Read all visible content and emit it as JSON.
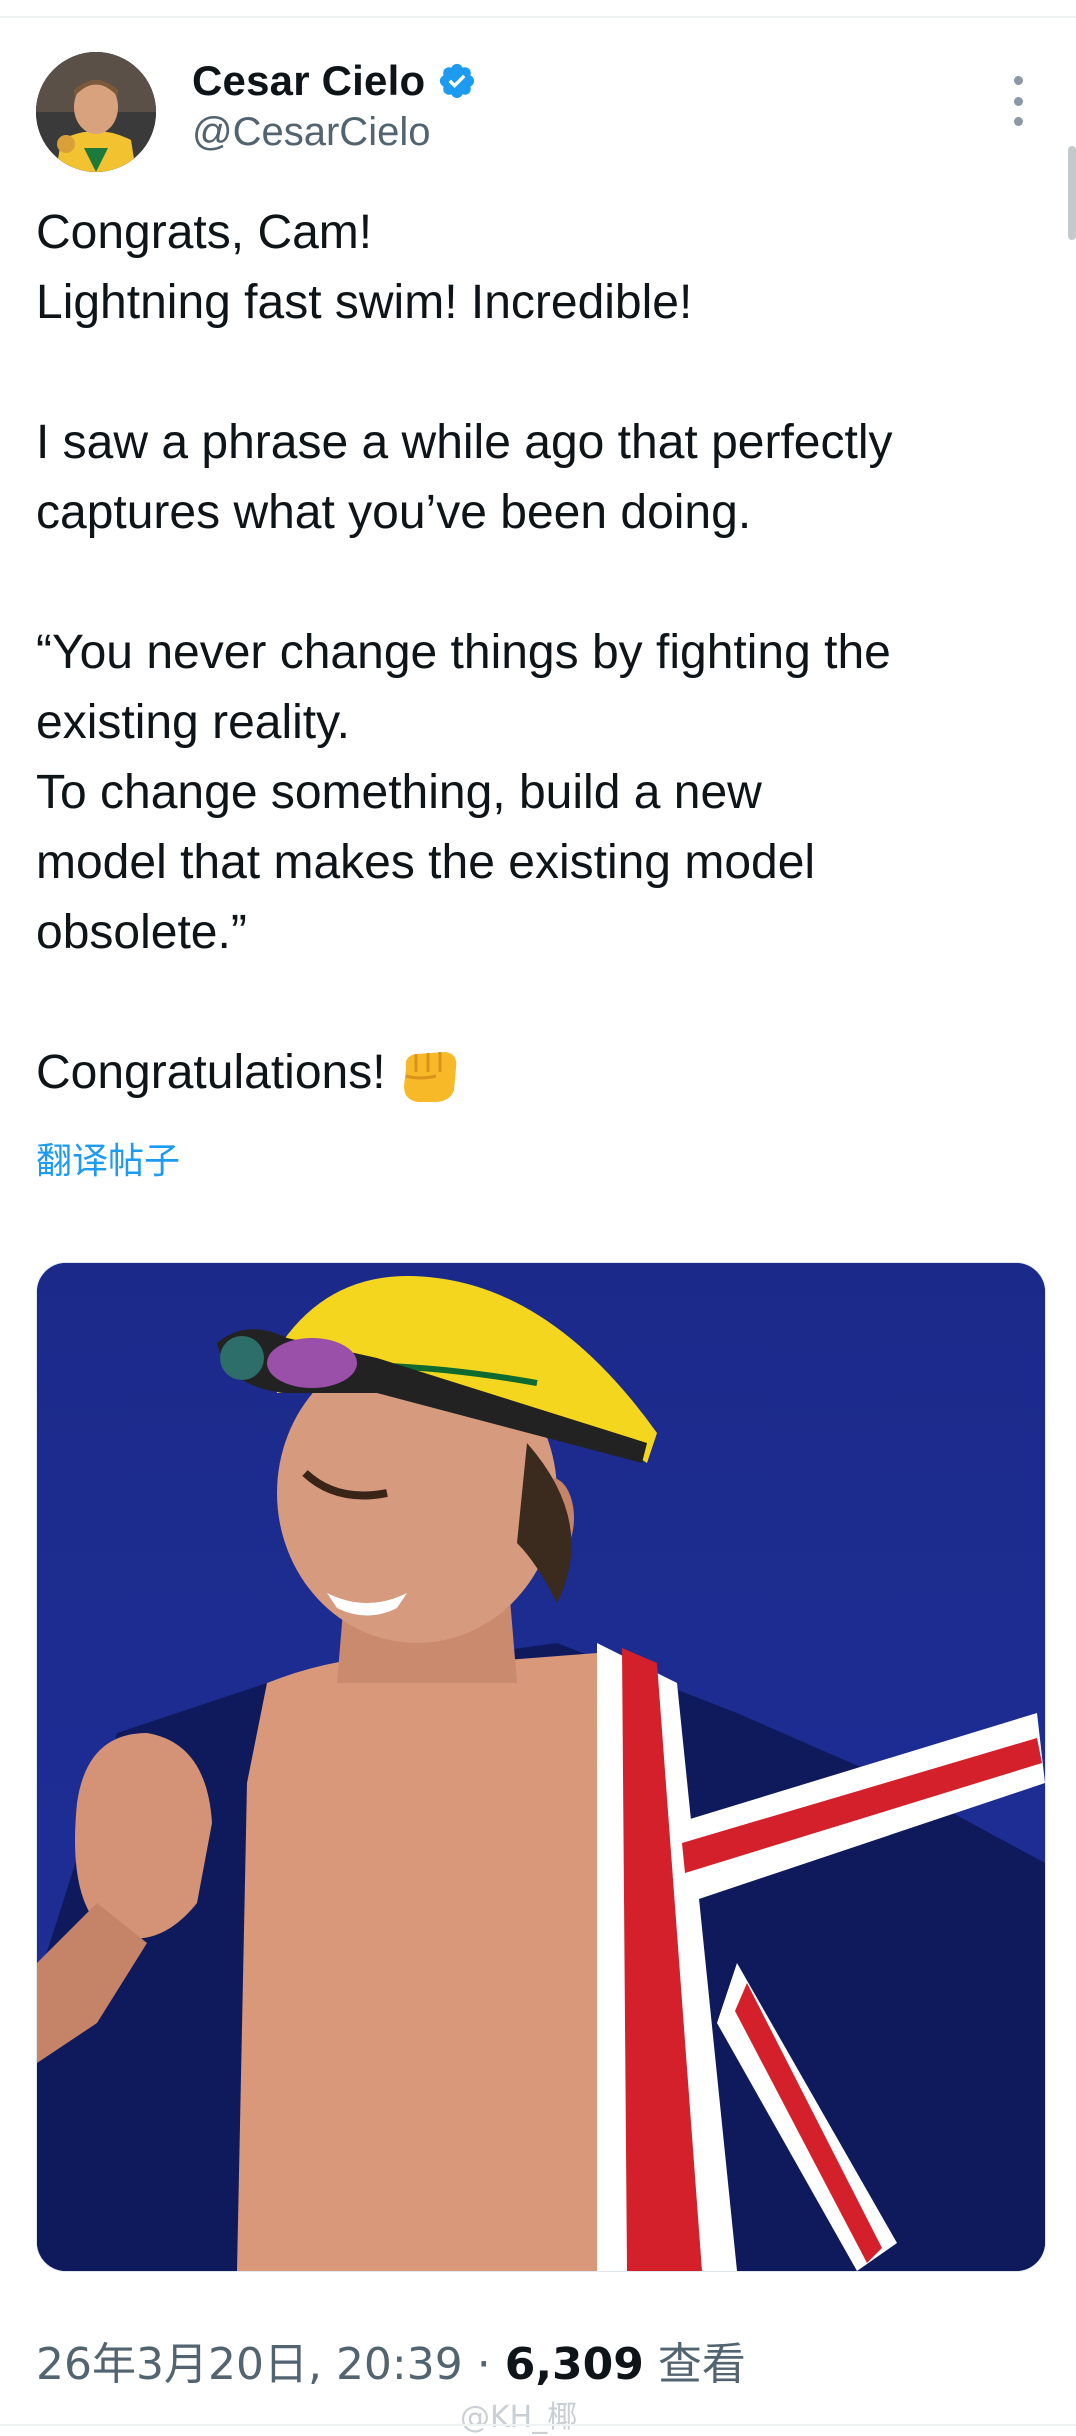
{
  "author": {
    "display_name": "Cesar Cielo",
    "handle": "@CesarCielo",
    "verified": true
  },
  "tweet": {
    "lines": [
      "Congrats, Cam!",
      "Lightning fast swim! Incredible!",
      "",
      "I saw a phrase a while ago that perfectly",
      "captures what you’ve been doing.",
      "",
      "“You never change things by fighting the",
      "existing reality.",
      "To change something, build a new",
      "model that makes the existing model",
      "obsolete.”",
      "",
      "Congratulations!"
    ],
    "translate_label": "翻译帖子"
  },
  "meta": {
    "timestamp": "26年3月20日, 20:39",
    "separator": " · ",
    "views_count": "6,309",
    "views_label": "查看"
  },
  "watermark": "@KH_椰",
  "icons": {
    "verified": "verified-badge-icon",
    "more": "more-options-icon",
    "fist": "oncoming-fist-emoji"
  },
  "colors": {
    "accent": "#1d9bf0",
    "text": "#0f1419",
    "secondary": "#536471"
  }
}
